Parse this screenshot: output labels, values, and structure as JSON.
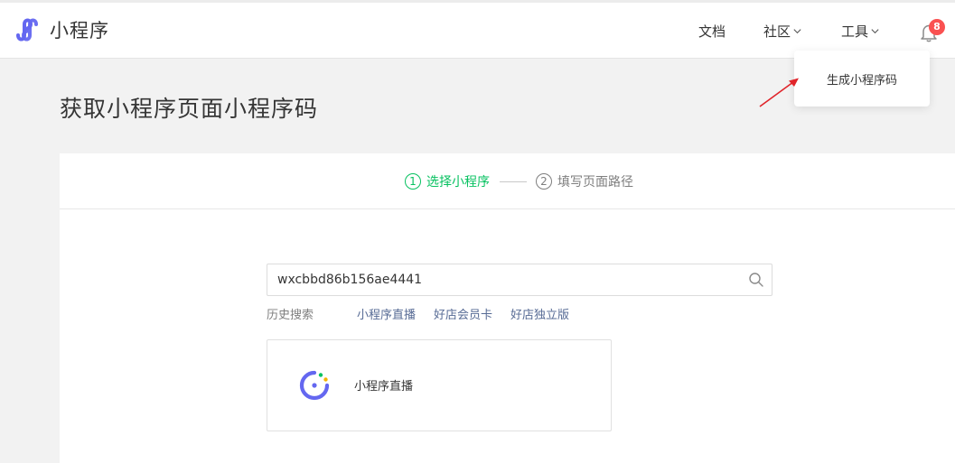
{
  "header": {
    "logo_text": "小程序",
    "nav": {
      "docs": "文档",
      "community": "社区",
      "tools": "工具"
    },
    "notification_count": "8"
  },
  "dropdown": {
    "item": "生成小程序码"
  },
  "page": {
    "title": "获取小程序页面小程序码"
  },
  "steps": [
    {
      "num": "1",
      "label": "选择小程序",
      "active": true
    },
    {
      "num": "2",
      "label": "填写页面路径",
      "active": false
    }
  ],
  "search": {
    "value": "wxcbbd86b156ae4441"
  },
  "history": {
    "label": "历史搜索",
    "items": [
      "小程序直播",
      "好店会员卡",
      "好店独立版"
    ]
  },
  "result": {
    "name": "小程序直播"
  },
  "colors": {
    "accent": "#07c160",
    "link": "#576b95",
    "logo": "#6467f0",
    "badge": "#fa5151",
    "arrow": "#e0242a"
  }
}
